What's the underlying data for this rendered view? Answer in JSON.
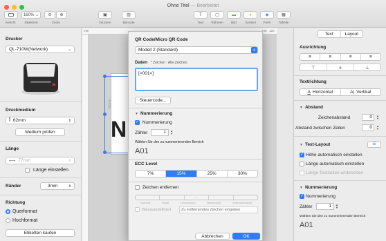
{
  "window": {
    "title": "Ohne Titel",
    "edited": "— Bearbeitet",
    "colors": {
      "close": "#fd5f57",
      "minimize": "#febb2e",
      "zoom": "#28c840",
      "accent": "#2f7cf6"
    }
  },
  "toolbar": {
    "zoom_value": "160%",
    "labels": {
      "view": "Ansicht",
      "scale": "Skalieren",
      "zoom": "Zoom",
      "print": "Drucken",
      "barcode": "Barcode",
      "text": "Text",
      "frame": "Rahmen",
      "image": "Bild",
      "symbol": "Symbol",
      "form": "Form",
      "table": "Tabelle"
    }
  },
  "left": {
    "printer_title": "Drucker",
    "printer_value": "QL-710W(Network)",
    "media_title": "Druckmedium",
    "media_value": "62mm",
    "media_check": "Medium prüfen",
    "length_title": "Länge",
    "length_value": "77mm",
    "length_auto": "Länge einstellen",
    "margins_title": "Ränder",
    "margins_value": "3mm",
    "direction_title": "Richtung",
    "landscape": "Querformat",
    "portrait": "Hochformat",
    "buy_labels": "Etiketten kaufen"
  },
  "canvas": {
    "ruler_mm": "mm",
    "ruler_100": "100",
    "ruler_120": "120",
    "width_label": "62mm"
  },
  "dialog": {
    "qr_title": "QR Code/Micro QR Code",
    "model_value": "Modell 2 (Standard)",
    "data_title": "Daten",
    "data_hint": "* Zeichen : Alle Zeichen",
    "data_value": "[>001<]",
    "control_code": "Steuercode...",
    "numbering_title": "Nummerierung",
    "numbering_check": "Nummerierung",
    "counter_label": "Zähler",
    "counter_value": "1",
    "select_range": "Wählen Sie den zu nummerierenden Bereich",
    "range_preview": "A01",
    "ecc_title": "ECC Level",
    "ecc_levels": [
      "7%",
      "15%",
      "25%",
      "30%"
    ],
    "ecc_selected": "15%",
    "remove_chars": "Zeichen entfernen",
    "remove_types": [
      "Komma",
      "Punkt",
      "Leerzeichen",
      "Bindestrich",
      "Zeilenumbrüche"
    ],
    "user_defined": "Benutzerdefiniert",
    "user_placeholder": "Zu entfernendes Zeichen eingeben",
    "cancel": "Abbrechen",
    "ok": "OK"
  },
  "right": {
    "tabs": [
      "Text",
      "Layout"
    ],
    "alignment_title": "Ausrichtung",
    "text_direction_title": "Textrichtung",
    "horizontal": "Horizontal",
    "vertical": "Vertikal",
    "spacing_title": "Abstand",
    "char_spacing_label": "Zeichenabstand",
    "char_spacing_value": "0",
    "line_spacing_label": "Abstand zwischen Zeilen",
    "line_spacing_value": "0",
    "text_layout_title": "Text-Layout",
    "auto_height": "Höhe automatisch einstellen",
    "auto_length": "Länge automatisch einstellen",
    "wrap_text": "Lange Textzeilen umbrechen",
    "numbering_title": "Nummerierung",
    "numbering_check": "Nummerierung",
    "counter_label": "Zähler",
    "counter_value": "1",
    "select_range": "Wählen Sie den zu nummerierenden Bereich",
    "range_preview": "A01"
  }
}
